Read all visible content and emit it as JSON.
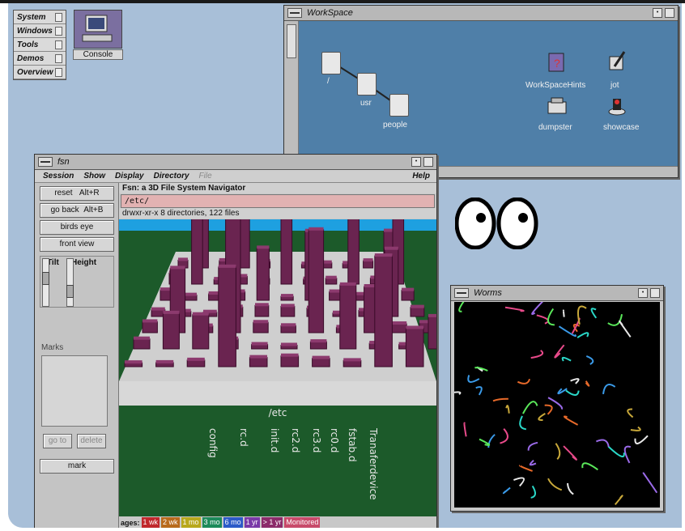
{
  "toolchest": {
    "items": [
      "System",
      "Windows",
      "Tools",
      "Demos",
      "Overview"
    ]
  },
  "console": {
    "label": "Console"
  },
  "workspace": {
    "title": "WorkSpace",
    "folders": [
      "/",
      "usr",
      "people"
    ],
    "icons": [
      {
        "label": "WorkSpaceHints",
        "icon": "help-book-icon"
      },
      {
        "label": "jot",
        "icon": "jot-pen-icon"
      },
      {
        "label": "dumpster",
        "icon": "dumpster-icon"
      },
      {
        "label": "showcase",
        "icon": "showcase-icon"
      }
    ]
  },
  "fsn": {
    "title": "fsn",
    "menu": [
      "Session",
      "Show",
      "Display",
      "Directory"
    ],
    "menu_disabled": "File",
    "help": "Help",
    "buttons": {
      "reset": "reset",
      "reset_key": "Alt+R",
      "go_back": "go back",
      "go_back_key": "Alt+B",
      "birds_eye": "birds eye",
      "front_view": "front view",
      "go_to": "go to",
      "delete": "delete",
      "mark": "mark"
    },
    "tilt": "Tilt",
    "height": "Height",
    "marks": "Marks",
    "heading": "Fsn:  a 3D File System Navigator",
    "path": "/etc/",
    "dirinfo": "drwxr-xr-x 8 directories, 122 files",
    "dir_label": "/etc",
    "subdirs": [
      "config",
      "rc.d",
      "init.d",
      "rc2.d",
      "rc3.d",
      "rc0.d",
      "fstab.d",
      "Tranaferdevice"
    ],
    "ages_label": "ages:",
    "ages": [
      {
        "label": "1 wk",
        "color": "#c0282c"
      },
      {
        "label": "2 wk",
        "color": "#b86a1c"
      },
      {
        "label": "1 mo",
        "color": "#b8a81c"
      },
      {
        "label": "3 mo",
        "color": "#1c8a5a"
      },
      {
        "label": "6 mo",
        "color": "#2c5ac8"
      },
      {
        "label": "1 yr",
        "color": "#7a3aa8"
      },
      {
        "label": "> 1 yr",
        "color": "#8c2c6a"
      },
      {
        "label": "Monitored",
        "color": "#c84a6a"
      }
    ]
  },
  "worms": {
    "title": "Worms"
  }
}
